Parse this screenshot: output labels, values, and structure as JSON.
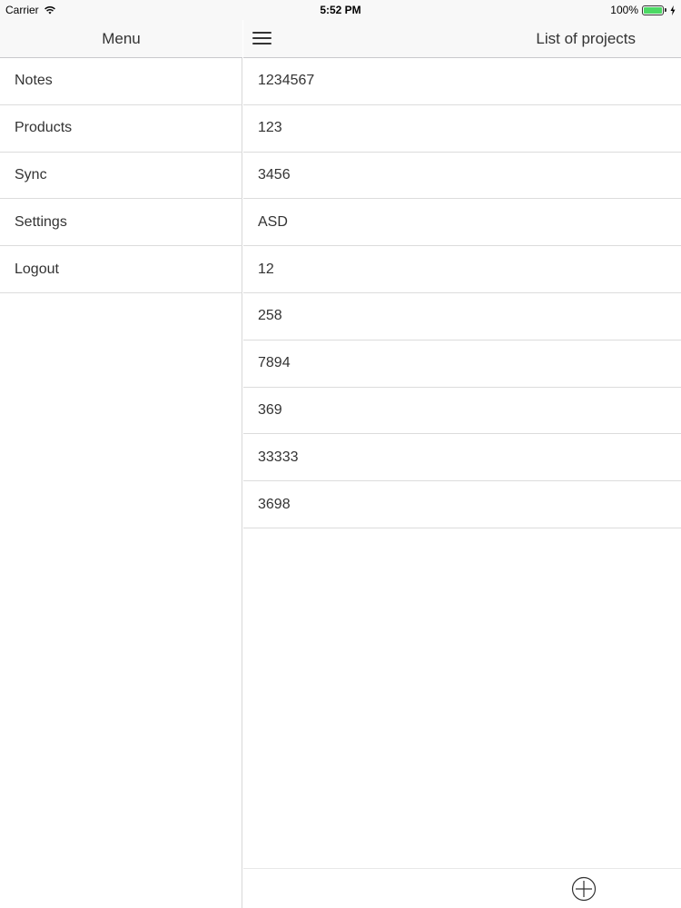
{
  "status_bar": {
    "carrier": "Carrier",
    "time": "5:52 PM",
    "battery": "100%"
  },
  "menu": {
    "title": "Menu",
    "items": [
      {
        "label": "Notes"
      },
      {
        "label": "Products"
      },
      {
        "label": "Sync"
      },
      {
        "label": "Settings"
      },
      {
        "label": "Logout"
      }
    ]
  },
  "projects": {
    "title": "List of projects",
    "items": [
      {
        "label": "1234567"
      },
      {
        "label": "123"
      },
      {
        "label": "3456"
      },
      {
        "label": "ASD"
      },
      {
        "label": "12"
      },
      {
        "label": "258"
      },
      {
        "label": "7894"
      },
      {
        "label": "369"
      },
      {
        "label": "33333"
      },
      {
        "label": "3698"
      }
    ]
  },
  "icons": {
    "wifi": "wifi-icon",
    "battery": "battery-icon",
    "charging": "charging-bolt-icon",
    "menu": "hamburger-menu-icon",
    "add": "add-circle-icon"
  },
  "colors": {
    "battery_fill": "#4cd964",
    "bar_background": "#f8f8f8"
  }
}
